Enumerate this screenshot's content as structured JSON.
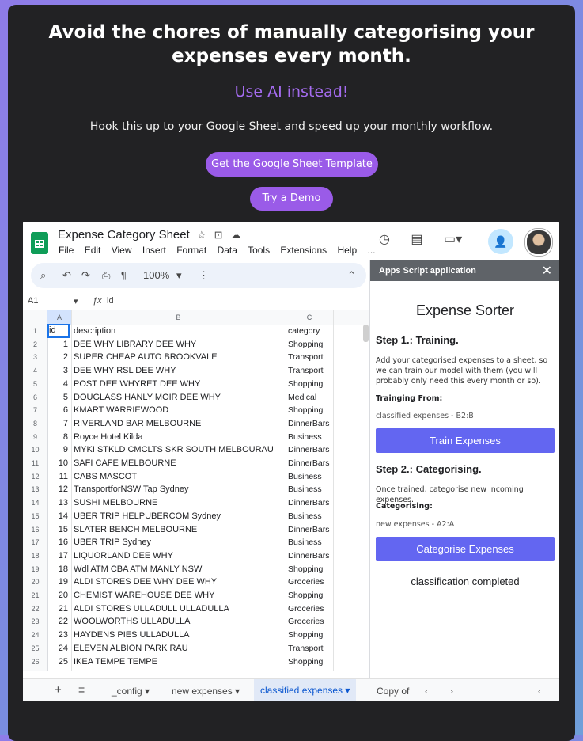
{
  "hero": {
    "title": "Avoid the chores of manually categorising your expenses every month.",
    "subtitle": "Use AI instead!",
    "description": "Hook this up to your Google Sheet and speed up your monthly workflow.",
    "template_button": "Get the Google Sheet Template",
    "demo_button": "Try a Demo"
  },
  "sheet": {
    "title": "Expense Category Sheet",
    "menu": [
      "File",
      "Edit",
      "View",
      "Insert",
      "Format",
      "Data",
      "Tools",
      "Extensions",
      "Help",
      "..."
    ],
    "zoom": "100%",
    "cell_ref": "A1",
    "formula": "id",
    "columns": [
      "A",
      "B",
      "C"
    ],
    "header_row": {
      "id": "id",
      "description": "description",
      "category": "category"
    },
    "rows": [
      {
        "id": "1",
        "description": "DEE WHY LIBRARY DEE WHY",
        "category": "Shopping"
      },
      {
        "id": "2",
        "description": "SUPER CHEAP AUTO BROOKVALE",
        "category": "Transport"
      },
      {
        "id": "3",
        "description": "DEE WHY RSL DEE WHY",
        "category": "Transport"
      },
      {
        "id": "4",
        "description": "POST DEE WHYRET DEE WHY",
        "category": "Shopping"
      },
      {
        "id": "5",
        "description": "DOUGLASS HANLY MOIR DEE WHY",
        "category": "Medical"
      },
      {
        "id": "6",
        "description": "KMART WARRIEWOOD",
        "category": "Shopping"
      },
      {
        "id": "7",
        "description": "RIVERLAND BAR MELBOURNE",
        "category": "DinnerBars"
      },
      {
        "id": "8",
        "description": "Royce Hotel Kilda",
        "category": "Business"
      },
      {
        "id": "9",
        "description": "MYKI STKLD CMCLTS SKR SOUTH MELBOURAU",
        "category": "DinnerBars"
      },
      {
        "id": "10",
        "description": "SAFI CAFE MELBOURNE",
        "category": "DinnerBars"
      },
      {
        "id": "11",
        "description": "CABS MASCOT",
        "category": "Business"
      },
      {
        "id": "12",
        "description": "TransportforNSW Tap Sydney",
        "category": "Business"
      },
      {
        "id": "13",
        "description": "SUSHI MELBOURNE",
        "category": "DinnerBars"
      },
      {
        "id": "14",
        "description": "UBER TRIP HELPUBERCOM Sydney",
        "category": "Business"
      },
      {
        "id": "15",
        "description": "SLATER BENCH MELBOURNE",
        "category": "DinnerBars"
      },
      {
        "id": "16",
        "description": "UBER TRIP Sydney",
        "category": "Business"
      },
      {
        "id": "17",
        "description": "LIQUORLAND DEE WHY",
        "category": "DinnerBars"
      },
      {
        "id": "18",
        "description": "Wdl ATM CBA ATM MANLY NSW",
        "category": "Shopping"
      },
      {
        "id": "19",
        "description": "ALDI STORES DEE WHY DEE WHY",
        "category": "Groceries"
      },
      {
        "id": "20",
        "description": "CHEMIST WAREHOUSE DEE WHY",
        "category": "Shopping"
      },
      {
        "id": "21",
        "description": "ALDI STORES ULLADULL ULLADULLA",
        "category": "Groceries"
      },
      {
        "id": "22",
        "description": "WOOLWORTHS ULLADULLA",
        "category": "Groceries"
      },
      {
        "id": "23",
        "description": "HAYDENS PIES ULLADULLA",
        "category": "Shopping"
      },
      {
        "id": "24",
        "description": "ELEVEN ALBION PARK RAU",
        "category": "Transport"
      },
      {
        "id": "25",
        "description": "IKEA TEMPE TEMPE",
        "category": "Shopping"
      }
    ],
    "row_numbers": [
      "1",
      "2",
      "3",
      "4",
      "5",
      "6",
      "7",
      "8",
      "9",
      "10",
      "11",
      "12",
      "13",
      "14",
      "15",
      "16",
      "17",
      "18",
      "19",
      "20",
      "21",
      "22",
      "23",
      "24",
      "25",
      "26"
    ],
    "tabs": [
      "_config",
      "new expenses",
      "classified expenses",
      "Copy of"
    ]
  },
  "panel": {
    "header": "Apps Script application",
    "title": "Expense Sorter",
    "step1_title": "Step 1.: Training.",
    "step1_text": "Add your categorised expenses to a sheet, so we can train our model with them (you will probably only need this every month or so).",
    "training_label": "Trainging From:",
    "training_value": "classified expenses - B2:B",
    "train_button": "Train Expenses",
    "step2_title": "Step 2.: Categorising.",
    "step2_text": "Once trained, categorise new incoming expenses.",
    "categorising_label": "Categorising:",
    "categorising_value": "new expenses - A2:A",
    "categorise_button": "Categorise Expenses",
    "status": "classification completed"
  }
}
